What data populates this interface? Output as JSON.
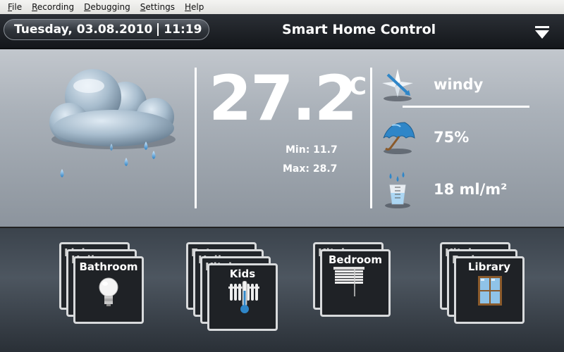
{
  "menu": {
    "items": [
      "File",
      "Recording",
      "Debugging",
      "Settings",
      "Help"
    ]
  },
  "header": {
    "date": "Tuesday, 03.08.2010",
    "time": "11:19",
    "title": "Smart Home Control"
  },
  "weather": {
    "condition_icon": "rain-cloud-icon",
    "temperature": "27.2",
    "unit": "°C",
    "min": "Min: 11.7",
    "max": "Max: 28.7",
    "wind": "windy",
    "humidity": "75%",
    "rainfall": "18 ml/m²"
  },
  "rooms": [
    {
      "stack": [
        "Living",
        "Hall"
      ],
      "front": "Bathroom",
      "icon": "light-bulb-icon"
    },
    {
      "stack": [
        "Entrance",
        "Hall",
        "Kitchen"
      ],
      "front": "Kids",
      "icon": "radiator-thermometer-icon"
    },
    {
      "stack": [
        "Kitchen"
      ],
      "front": "Bedroom",
      "icon": "window-blinds-icon"
    },
    {
      "stack": [
        "Kitchen",
        "Bedroom"
      ],
      "front": "Library",
      "icon": "window-icon"
    }
  ],
  "colors": {
    "accent_blue": "#2f86c8",
    "panel_light": "#c2c7cd",
    "card_border": "#d8dadc"
  }
}
